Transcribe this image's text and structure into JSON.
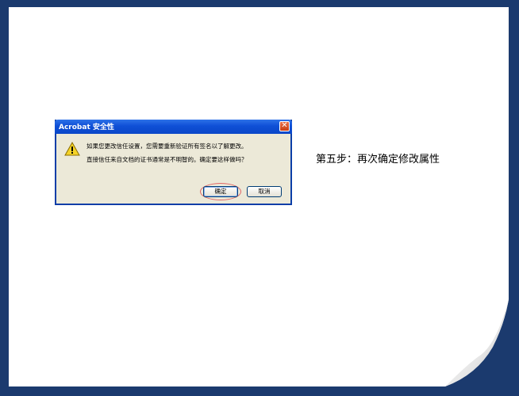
{
  "dialog": {
    "title": "Acrobat 安全性",
    "message_line1": "如果您更改信任设置，您需要重新验证所有签名以了解更改。",
    "message_line2": "直接信任来自文档的证书通常是不明智的。确定要这样做吗？",
    "ok_label": "确定",
    "cancel_label": "取消",
    "close_glyph": "✕"
  },
  "annotation": {
    "step_text": "第五步：再次确定修改属性"
  },
  "colors": {
    "frame": "#1b3a6e",
    "titlebar": "#0f4fd6",
    "dialog_bg": "#ece9d8",
    "highlight_circle": "#e06666"
  }
}
